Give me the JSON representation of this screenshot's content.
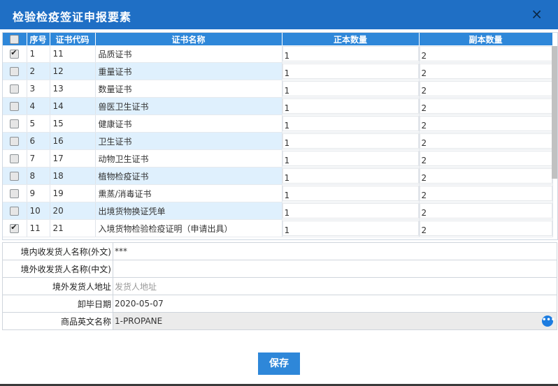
{
  "dialog": {
    "title": "检验检疫签证申报要素",
    "close": "×"
  },
  "grid": {
    "columns": [
      "",
      "序号",
      "证书代码",
      "证书名称",
      "正本数量",
      "副本数量"
    ],
    "rows": [
      {
        "checked": true,
        "seq": "1",
        "code": "11",
        "name": "品质证书",
        "orig": "1",
        "copy": "2"
      },
      {
        "checked": false,
        "seq": "2",
        "code": "12",
        "name": "重量证书",
        "orig": "1",
        "copy": "2"
      },
      {
        "checked": false,
        "seq": "3",
        "code": "13",
        "name": "数量证书",
        "orig": "1",
        "copy": "2"
      },
      {
        "checked": false,
        "seq": "4",
        "code": "14",
        "name": "兽医卫生证书",
        "orig": "1",
        "copy": "2"
      },
      {
        "checked": false,
        "seq": "5",
        "code": "15",
        "name": "健康证书",
        "orig": "1",
        "copy": "2"
      },
      {
        "checked": false,
        "seq": "6",
        "code": "16",
        "name": "卫生证书",
        "orig": "1",
        "copy": "2"
      },
      {
        "checked": false,
        "seq": "7",
        "code": "17",
        "name": "动物卫生证书",
        "orig": "1",
        "copy": "2"
      },
      {
        "checked": false,
        "seq": "8",
        "code": "18",
        "name": "植物检疫证书",
        "orig": "1",
        "copy": "2"
      },
      {
        "checked": false,
        "seq": "9",
        "code": "19",
        "name": "熏蒸/消毒证书",
        "orig": "1",
        "copy": "2"
      },
      {
        "checked": false,
        "seq": "10",
        "code": "20",
        "name": "出境货物换证凭单",
        "orig": "1",
        "copy": "2"
      },
      {
        "checked": true,
        "seq": "11",
        "code": "21",
        "name": "入境货物检验检疫证明（申请出具）",
        "orig": "1",
        "copy": "2"
      }
    ]
  },
  "form": {
    "consignee_foreign_label": "境内收发货人名称(外文)",
    "consignee_foreign_value": "***",
    "overseas_cn_label": "境外收发货人名称(中文)",
    "overseas_cn_value": "",
    "overseas_addr_label": "境外发货人地址",
    "overseas_addr_placeholder": "发货人地址",
    "unload_date_label": "卸毕日期",
    "unload_date_value": "2020-05-07",
    "goods_en_label": "商品英文名称",
    "goods_en_value": "1-PROPANE"
  },
  "actions": {
    "save_label": "保存"
  }
}
